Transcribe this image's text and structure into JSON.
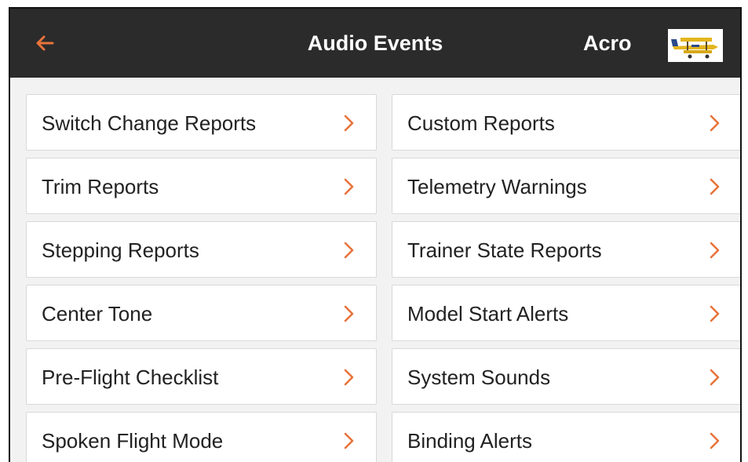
{
  "header": {
    "title": "Audio Events",
    "model_name": "Acro",
    "back_icon": "arrow-left-icon",
    "model_icon": "airplane-thumbnail"
  },
  "colors": {
    "header_bg": "#2b2b2b",
    "accent": "#e8733a",
    "page_bg": "#f2f2f2",
    "tile_bg": "#ffffff"
  },
  "menu": {
    "left": [
      "Switch Change Reports",
      "Trim Reports",
      "Stepping Reports",
      "Center Tone",
      "Pre-Flight Checklist",
      "Spoken Flight Mode"
    ],
    "right": [
      "Custom Reports",
      "Telemetry Warnings",
      "Trainer State Reports",
      "Model Start Alerts",
      "System Sounds",
      "Binding Alerts"
    ],
    "chevron_icon": "chevron-right-icon"
  }
}
